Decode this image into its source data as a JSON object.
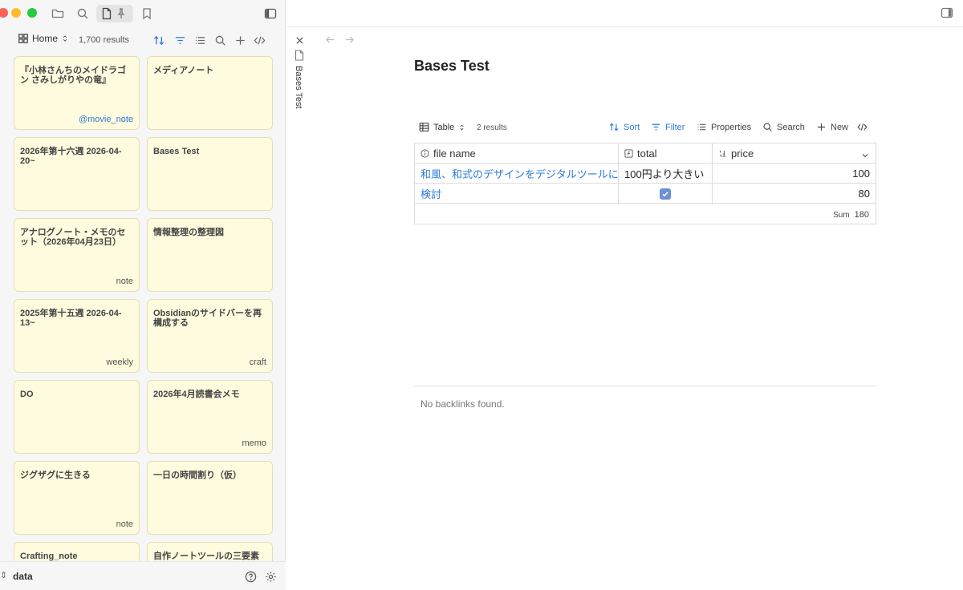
{
  "sidebar": {
    "view_name": "Home",
    "results_count": "1,700 results",
    "cards": [
      {
        "title": "『小林さんちのメイドラゴン さみしがりやの竜』",
        "tag": "@movie_note",
        "tag_is_link": true
      },
      {
        "title": "メディアノート",
        "tag": ""
      },
      {
        "title": "2026年第十六週 2026-04-20~",
        "tag": ""
      },
      {
        "title": "Bases Test",
        "tag": ""
      },
      {
        "title": "アナログノート・メモのセット（2026年04月23日）",
        "tag": "note"
      },
      {
        "title": "情報整理の整理図",
        "tag": ""
      },
      {
        "title": "2025年第十五週 2026-04-13~",
        "tag": "weekly"
      },
      {
        "title": "Obsidianのサイドバーを再構成する",
        "tag": "craft"
      },
      {
        "title": "DO",
        "tag": ""
      },
      {
        "title": "2026年4月読書会メモ",
        "tag": "memo"
      },
      {
        "title": "ジグザグに生きる",
        "tag": "note"
      },
      {
        "title": "一日の時間割り（仮）",
        "tag": ""
      },
      {
        "title": "Crafting_note",
        "tag": ""
      },
      {
        "title": "自作ノートツールの三要素",
        "tag": ""
      }
    ],
    "vault_name": "data"
  },
  "tab": {
    "label": "Bases Test"
  },
  "page": {
    "title": "Bases Test"
  },
  "base": {
    "view_label": "Table",
    "results_count": "2 results",
    "sort_label": "Sort",
    "filter_label": "Filter",
    "properties_label": "Properties",
    "search_label": "Search",
    "new_label": "New",
    "columns": {
      "file_name": "file name",
      "total": "total",
      "price": "price"
    },
    "rows": [
      {
        "file_name": "和風、和式のデザインをデジタルツールに",
        "total": "100円より大きい",
        "price": "100"
      },
      {
        "file_name": "検討",
        "total_checked": true,
        "price": "80"
      }
    ],
    "summary_label": "Sum",
    "summary_value": "180"
  },
  "backlinks": {
    "empty_text": "No backlinks found."
  },
  "colors": {
    "accent": "#2a7bd6",
    "card_bg": "#fffbde",
    "checkbox": "#6d8fd9"
  }
}
